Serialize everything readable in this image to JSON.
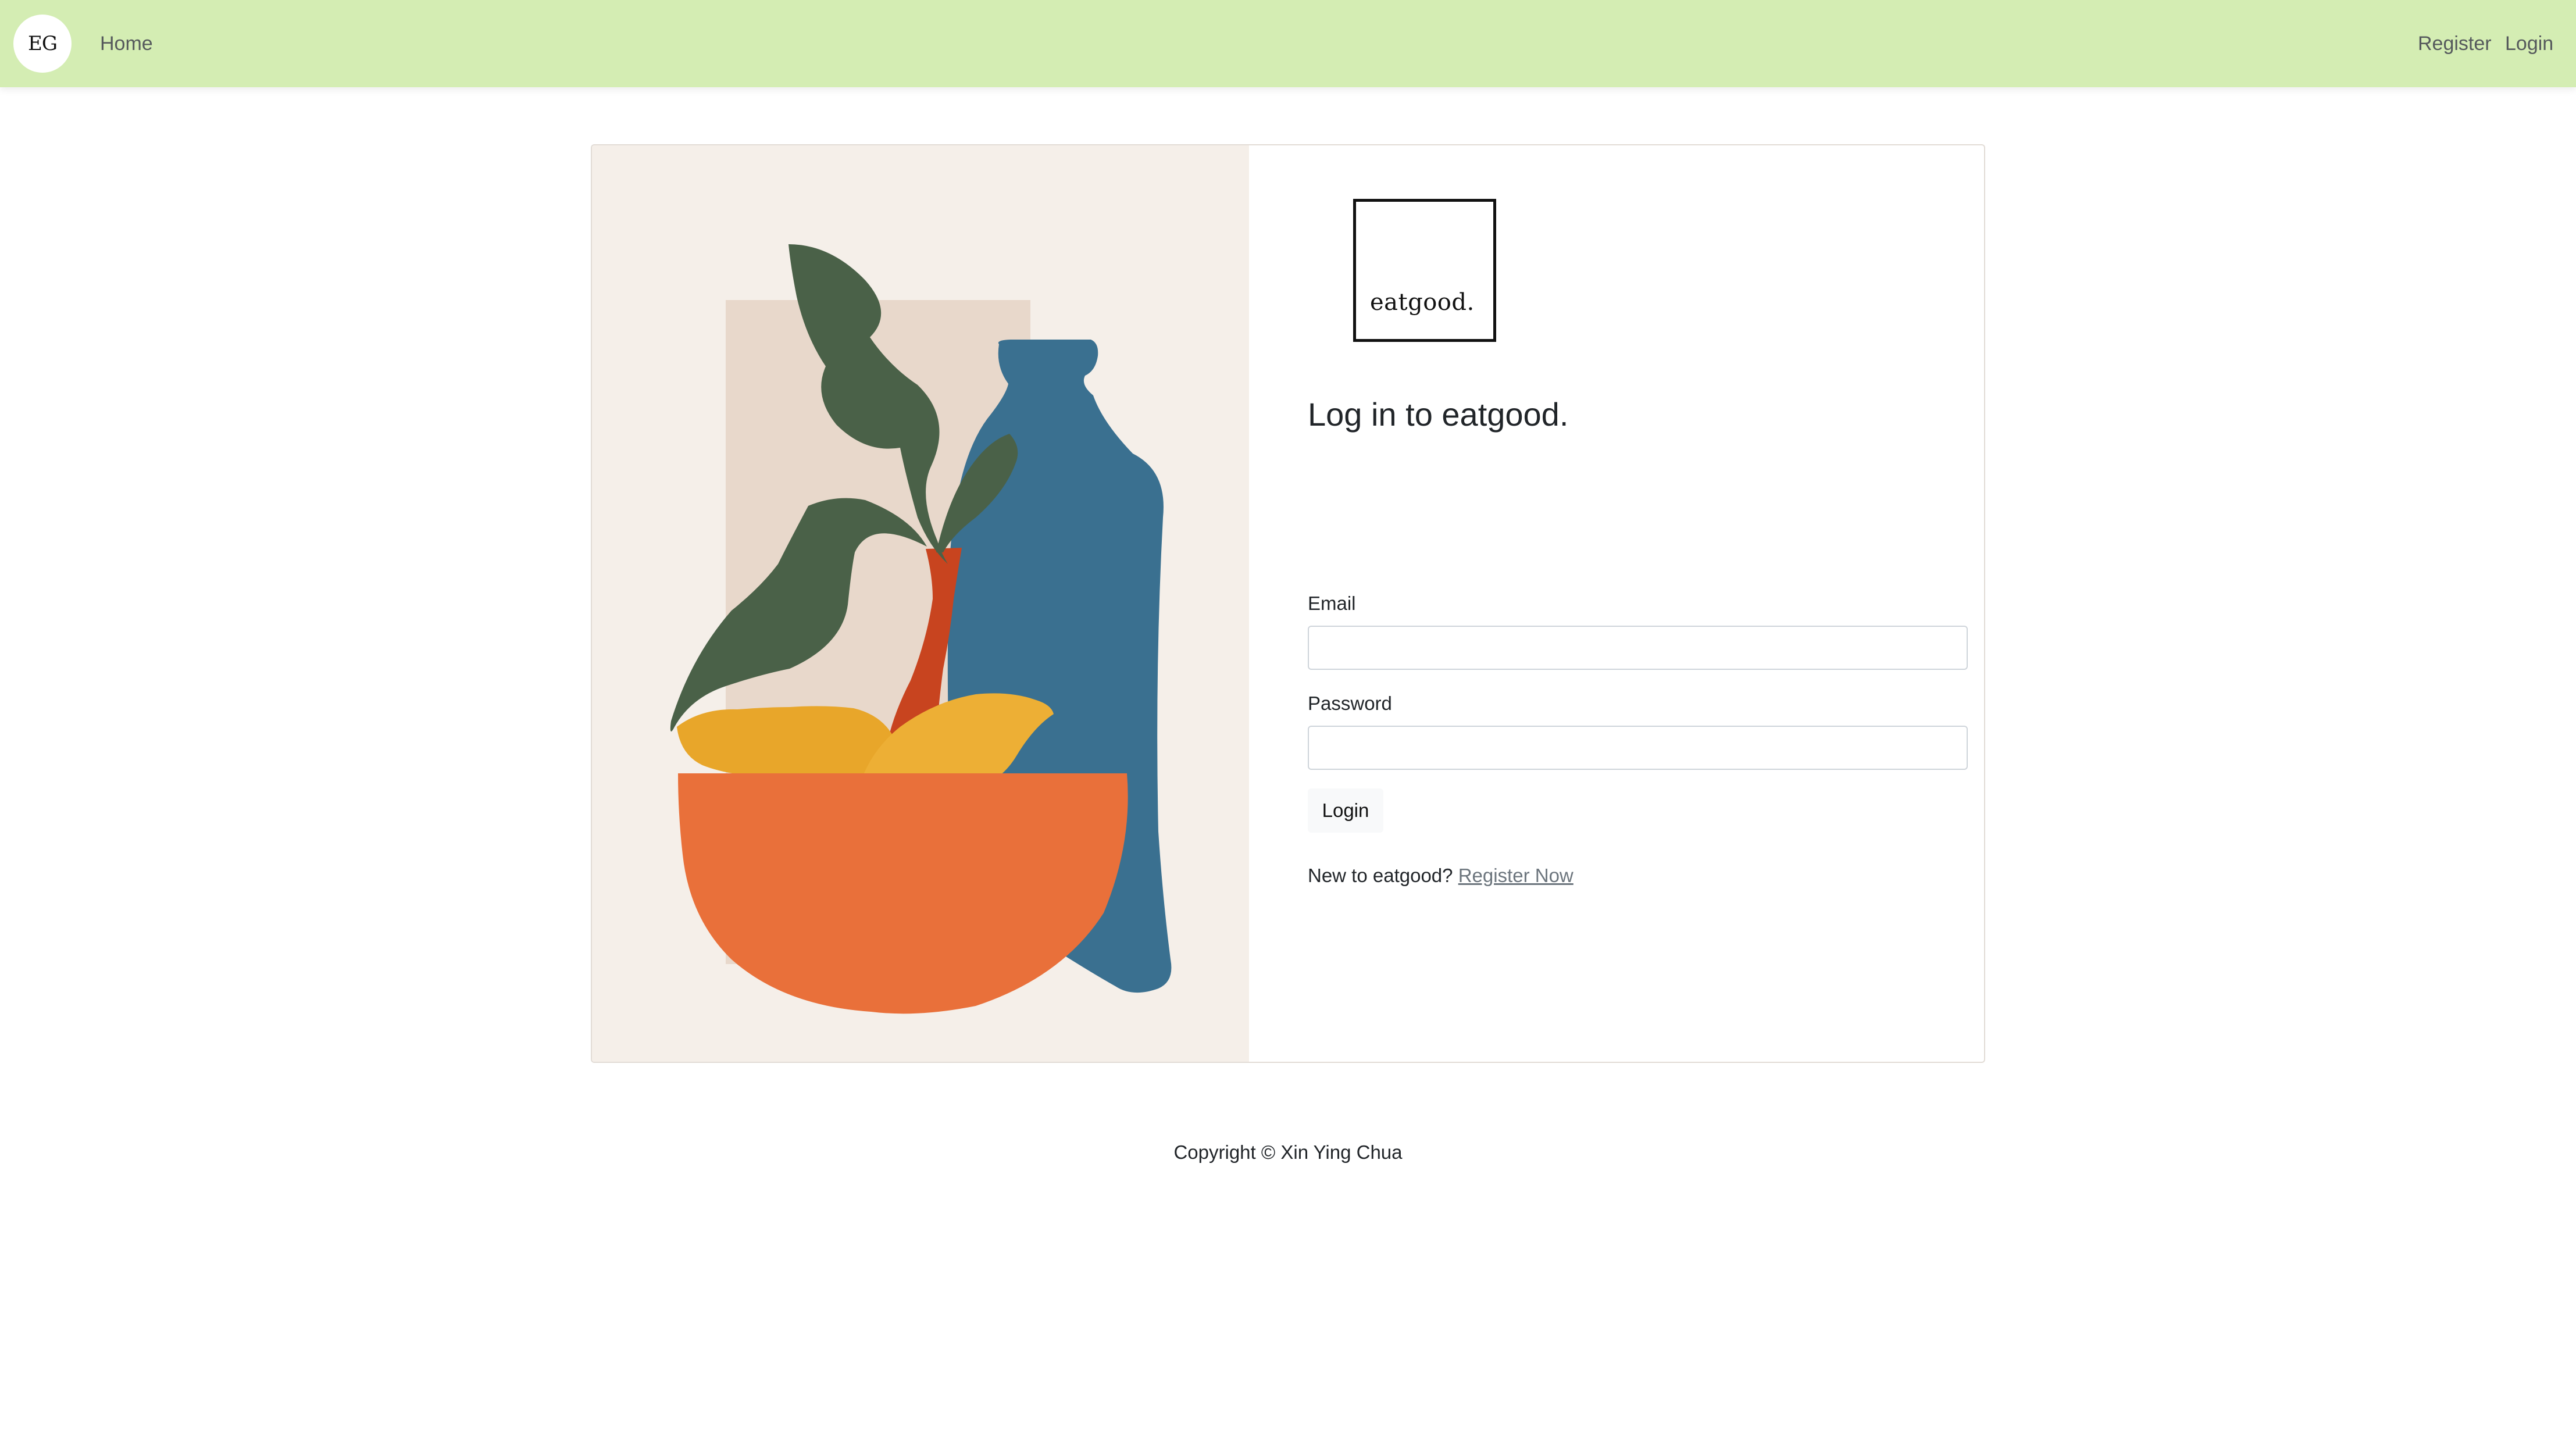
{
  "navbar": {
    "brand": "EG",
    "home_label": "Home",
    "register_label": "Register",
    "login_label": "Login",
    "background_color": "#d4edb3"
  },
  "illustration": {
    "subject": "abstract still life: leafy plant in red vase, blue bottle, bowl of yellow fruit",
    "colors": {
      "background": "#f5efe9",
      "panel": "#e8d8cb",
      "leaves": "#4a6148",
      "vase": "#c8441f",
      "bottle": "#3a7090",
      "fruit": "#e8a62a",
      "bowl": "#e9703a"
    }
  },
  "login_form": {
    "logo_text": "eatgood.",
    "title": "Log in to eatgood.",
    "email_label": "Email",
    "email_value": "",
    "email_placeholder": "",
    "password_label": "Password",
    "password_value": "",
    "password_placeholder": "",
    "submit_label": "Login",
    "register_prompt": "New to eatgood?",
    "register_link_label": "Register Now"
  },
  "footer": {
    "copyright": "Copyright © Xin Ying Chua"
  }
}
